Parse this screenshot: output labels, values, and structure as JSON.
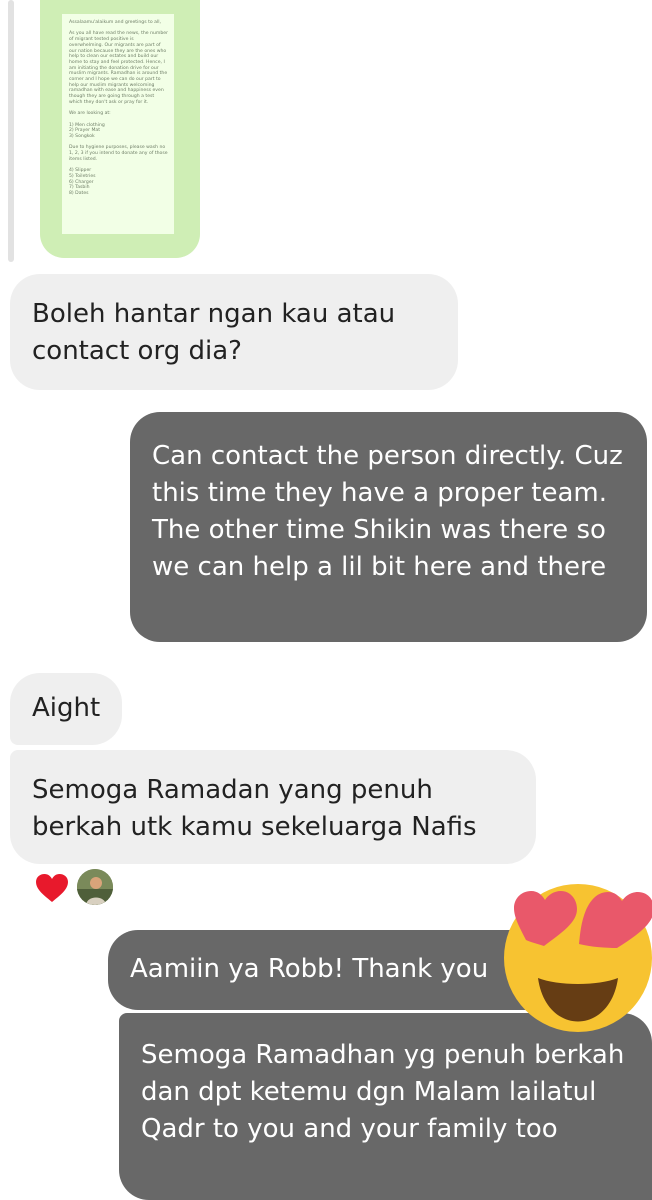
{
  "thread": {
    "attachment": {
      "type": "image",
      "document_text": "Assalaamu'alaikum and greetings to all,\n\nAs you all have read the news, the number of migrant tested positive is overwhelming. Our migrants are part of our nation because they are the ones who help to clean our estates and build our home to stay and feel protected. Hence, I am initiating the donation drive for our muslim migrants. Ramadhan is around the corner and I hope we can do our part to help our muslim migrants welcoming ramadhan with ease and happiness even though they are going through a test which they don't ask or pray for it.\n\nWe are looking at:\n\n1) Men clothing\n2) Prayer Mat\n3) Songkok\n\nDue to hygiene purposes, please wash no 1, 2, 3 if you intend to donate any of those items listed.\n\n4) Slipper\n5) Toiletries\n6) Charger\n7) Tasbih\n8) Dates"
    },
    "messages": [
      {
        "id": "b1",
        "sender": "other",
        "text": "Boleh hantar ngan kau atau contact org dia?"
      },
      {
        "id": "b2",
        "sender": "me",
        "text": "Can contact the person directly. Cuz this time they have a proper team. The other time Shikin was there so we can help a lil bit here and there"
      },
      {
        "id": "b3",
        "sender": "other",
        "text": "Aight"
      },
      {
        "id": "b4",
        "sender": "other",
        "text": "Semoga Ramadan yang penuh berkah utk kamu sekeluarga Nafis"
      },
      {
        "id": "b5",
        "sender": "me",
        "text": "Aamiin ya Robb! Thank you"
      },
      {
        "id": "b6",
        "sender": "me",
        "text": "Semoga Ramadhan yg penuh berkah dan dpt ketemu dgn Malam lailatul Qadr to you and your family too"
      }
    ],
    "reaction": {
      "icon": "heart-icon",
      "color": "#e8192c",
      "reactor": "avatar"
    },
    "sticker": {
      "icon": "heart-eyes-emoji"
    }
  },
  "colors": {
    "incoming_bubble": "#efefef",
    "outgoing_bubble": "#686868",
    "preview_bg": "#cfeeb5"
  }
}
